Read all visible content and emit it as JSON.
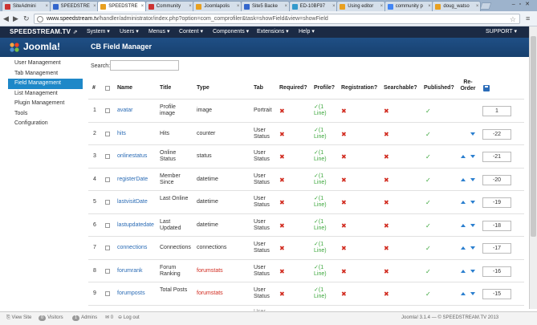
{
  "browser": {
    "tabs": [
      {
        "label": "SiteAdmini",
        "icon_color": "#cc3333"
      },
      {
        "label": "SPEEDSTRE",
        "icon_color": "#3366cc"
      },
      {
        "label": "SPEEDSTRE",
        "icon_color": "#e8a020"
      },
      {
        "label": "Community",
        "icon_color": "#cc3333"
      },
      {
        "label": "Joomlapolis",
        "icon_color": "#e8a020"
      },
      {
        "label": "Site5 Backe",
        "icon_color": "#3366cc"
      },
      {
        "label": "ED-10BF97",
        "icon_color": "#3399cc"
      },
      {
        "label": "Using editor",
        "icon_color": "#e8a020"
      },
      {
        "label": "community p",
        "icon_color": "#4285f4"
      },
      {
        "label": "doug_watso",
        "icon_color": "#e8a020"
      }
    ],
    "active_tab_index": 2,
    "url_host": "www.speedstream.tv",
    "url_path": "/handler/administrator/index.php?option=com_comprofiler&task=showField&view=showField"
  },
  "adminbar": {
    "brand": "SPEEDSTREAM.TV",
    "brand_ext": "⇗",
    "menus": [
      "System ▾",
      "Users ▾",
      "Menus ▾",
      "Content ▾",
      "Components ▾",
      "Extensions ▾",
      "Help ▾"
    ],
    "support": "SUPPORT ▾"
  },
  "header": {
    "logo_text": "Joomla!",
    "title": "CB Field Manager"
  },
  "sidebar": {
    "items": [
      "User Management",
      "Tab Management",
      "Field Management",
      "List Management",
      "Plugin Management",
      "Tools",
      "Configuration"
    ],
    "active_index": 2
  },
  "search": {
    "label": "Search:",
    "value": ""
  },
  "table": {
    "headers": {
      "num": "#",
      "name": "Name",
      "title": "Title",
      "type": "Type",
      "tab": "Tab",
      "required": "Required?",
      "profile": "Profile?",
      "registration": "Registration?",
      "searchable": "Searchable?",
      "published": "Published?",
      "reorder": "Re-Order"
    },
    "rows": [
      {
        "num": "1",
        "name": "avatar",
        "title": "Profile image",
        "type": "image",
        "type_red": false,
        "tab": "Portrait",
        "required": false,
        "profile": "✓(1 Line)",
        "registration": false,
        "searchable": false,
        "published": true,
        "up": false,
        "down": false,
        "order": "1"
      },
      {
        "num": "2",
        "name": "hits",
        "title": "Hits",
        "type": "counter",
        "type_red": false,
        "tab": "User Status",
        "required": false,
        "profile": "✓(1 Line)",
        "registration": false,
        "searchable": false,
        "published": true,
        "up": false,
        "down": true,
        "order": "-22"
      },
      {
        "num": "3",
        "name": "onlinestatus",
        "title": "Online Status",
        "type": "status",
        "type_red": false,
        "tab": "User Status",
        "required": false,
        "profile": "✓(1 Line)",
        "registration": false,
        "searchable": false,
        "published": true,
        "up": true,
        "down": true,
        "order": "-21"
      },
      {
        "num": "4",
        "name": "registerDate",
        "title": "Member Since",
        "type": "datetime",
        "type_red": false,
        "tab": "User Status",
        "required": false,
        "profile": "✓(1 Line)",
        "registration": false,
        "searchable": false,
        "published": true,
        "up": true,
        "down": true,
        "order": "-20"
      },
      {
        "num": "5",
        "name": "lastvisitDate",
        "title": "Last Online",
        "type": "datetime",
        "type_red": false,
        "tab": "User Status",
        "required": false,
        "profile": "✓(1 Line)",
        "registration": false,
        "searchable": false,
        "published": true,
        "up": true,
        "down": true,
        "order": "-19"
      },
      {
        "num": "6",
        "name": "lastupdatedate",
        "title": "Last Updated",
        "type": "datetime",
        "type_red": false,
        "tab": "User Status",
        "required": false,
        "profile": "✓(1 Line)",
        "registration": false,
        "searchable": false,
        "published": true,
        "up": true,
        "down": true,
        "order": "-18"
      },
      {
        "num": "7",
        "name": "connections",
        "title": "Connections",
        "type": "connections",
        "type_red": false,
        "tab": "User Status",
        "required": false,
        "profile": "✓(1 Line)",
        "registration": false,
        "searchable": false,
        "published": true,
        "up": true,
        "down": true,
        "order": "-17"
      },
      {
        "num": "8",
        "name": "forumrank",
        "title": "Forum Ranking",
        "type": "forumstats",
        "type_red": true,
        "tab": "User Status",
        "required": false,
        "profile": "✓(1 Line)",
        "registration": false,
        "searchable": false,
        "published": true,
        "up": true,
        "down": true,
        "order": "-16"
      },
      {
        "num": "9",
        "name": "forumposts",
        "title": "Total Posts",
        "type": "forumstats",
        "type_red": true,
        "tab": "User Status",
        "required": false,
        "profile": "✓(1 Line)",
        "registration": false,
        "searchable": false,
        "published": true,
        "up": true,
        "down": true,
        "order": "-15"
      }
    ],
    "partial_tab": "User"
  },
  "footer": {
    "view_site": "View Site",
    "visitors_count": "0",
    "visitors": "Visitors",
    "admins_count": "1",
    "admins": "Admins",
    "messages_count": "0",
    "logout": "Log out",
    "version": "Joomla! 3.1.4 — © SPEEDSTREAM.TV 2013"
  },
  "colors": {
    "admin_bar": "#1b2a44",
    "header": "#1f4f85",
    "active_sidebar": "#1e88c8",
    "link": "#2a6bb5",
    "no": "#d12b1f",
    "yes": "#3aa63a"
  }
}
